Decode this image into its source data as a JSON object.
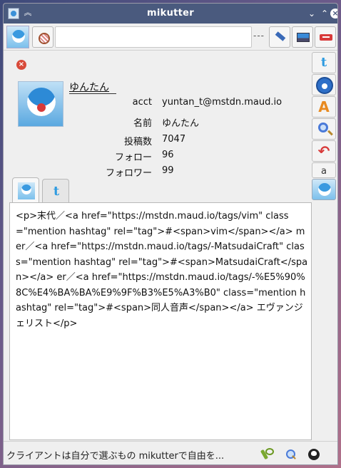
{
  "window": {
    "title": "mikutter",
    "collapse_glyph": "︽",
    "minimize_glyph": "⌄",
    "maximize_glyph": "⌃",
    "close_glyph": "×"
  },
  "toolbar": {
    "post_text": "",
    "separator": "---"
  },
  "profile": {
    "close_glyph": "×",
    "display_name": "ゆんたん",
    "fields": [
      {
        "label": "acct",
        "value": "yuntan_t@mstdn.maud.io"
      },
      {
        "label": "名前",
        "value": "ゆんたん"
      },
      {
        "label": "投稿数",
        "value": "7047"
      },
      {
        "label": "フォロー",
        "value": "96"
      },
      {
        "label": "フォロワー",
        "value": "99"
      }
    ],
    "bio": "<p>末代／<a href=\"https://mstdn.maud.io/tags/vim\" class=\"mention hashtag\" rel=\"tag\">#<span>vim</span></a> mer／<a href=\"https://mstdn.maud.io/tags/-MatsudaiCraft\" class=\"mention hashtag\" rel=\"tag\">#<span>MatsudaiCraft</span></a> er／<a href=\"https://mstdn.maud.io/tags/-%E5%90%8C%E4%BA%BA%E9%9F%B3%E5%A3%B0\" class=\"mention hashtag\" rel=\"tag\">#<span>同人音声</span></a> エヴァンジェリスト</p>"
  },
  "tabs": [
    {
      "icon": "avatar-icon"
    },
    {
      "icon": "twitter-icon",
      "glyph": "t"
    }
  ],
  "sidebar": {
    "twitter_glyph": "t",
    "font_glyph": "A",
    "undo_glyph": "↶",
    "letter": "a"
  },
  "status": {
    "message": "クライアントは自分で選ぶもの mikutterで自由を..."
  },
  "colors": {
    "titlebar": "#4a5a7e",
    "twitter": "#2f9be0",
    "accent_red": "#d83a3a"
  }
}
